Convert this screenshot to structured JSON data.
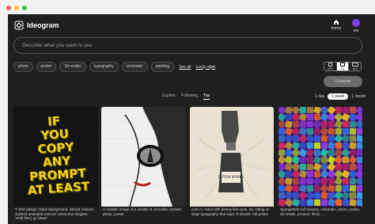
{
  "window": {
    "dot_colors": [
      "#f25f57",
      "#fbbc2e",
      "#27c840"
    ]
  },
  "header": {
    "brand": "Ideogram",
    "nav": [
      {
        "label": "home",
        "icon": "home-icon"
      },
      {
        "label": "me",
        "icon": "avatar"
      }
    ]
  },
  "search": {
    "placeholder": "Describe what you want to see"
  },
  "chips": [
    "photo",
    "poster",
    "3d render",
    "typography",
    "cinematic",
    "painting"
  ],
  "links": {
    "see_all": "See all",
    "lucky": "Lucky style"
  },
  "aspect_ratios": [
    {
      "label": "9/16",
      "active": false
    },
    {
      "label": "1/1",
      "active": true
    },
    {
      "label": "16/9",
      "active": false
    }
  ],
  "generate_label": "Generate",
  "tabs": [
    {
      "label": "Explore",
      "active": false
    },
    {
      "label": "Following",
      "active": false
    },
    {
      "label": "Top",
      "active": true
    }
  ],
  "time_filters": [
    {
      "label": "1 day",
      "active": false
    },
    {
      "label": "1 week",
      "active": true
    },
    {
      "label": "1 month",
      "active": false
    }
  ],
  "cards": [
    {
      "caption": "T-shirt design, black background, vibrant colours, stylized animated cartoon celery text slogans 'Hold fast | go down'",
      "poster_text": [
        "IF",
        "YOU",
        "COPY",
        "ANY",
        "PROMPT",
        "AT LEAST"
      ]
    },
    {
      "caption": "A realistic image of a cluster of crocodile crystals, photo, poster"
    },
    {
      "caption": "cute A.I robot with disney like eyes, 3d, sitting on large typography that says \"D Boosh\" full poster",
      "bottle_label": "POTION WORKS"
    },
    {
      "caption": "SpongeBob evil banana, cinematic, photo, poster, 3d render, product, filmic, ..."
    }
  ]
}
